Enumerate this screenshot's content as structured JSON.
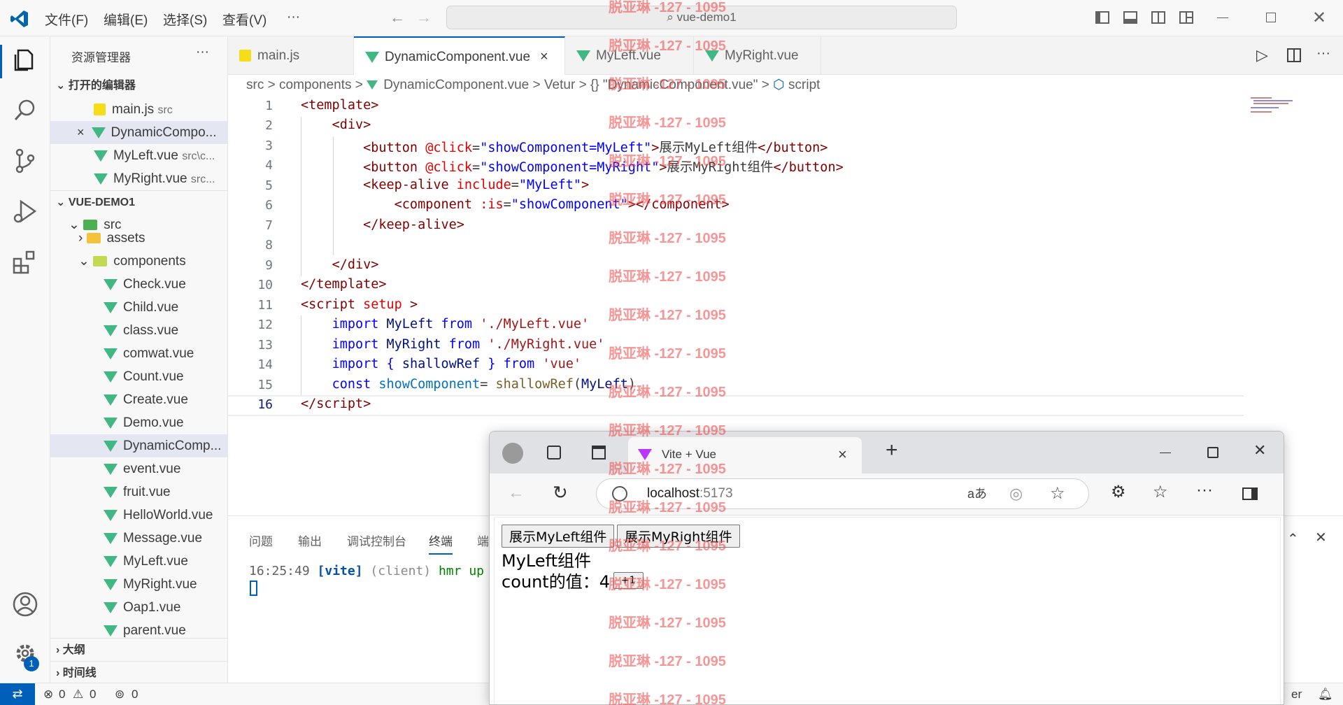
{
  "menu": [
    "文件(F)",
    "编辑(E)",
    "选择(S)",
    "查看(V)",
    "···"
  ],
  "window_title": "vue-demo1",
  "sidebar": {
    "title": "资源管理器",
    "more": "···",
    "open_editors_header": "打开的编辑器",
    "open_editors": [
      {
        "name": "main.js",
        "hint": "src",
        "type": "js"
      },
      {
        "name": "DynamicCompo...",
        "hint": "",
        "type": "vue",
        "close": "×"
      },
      {
        "name": "MyLeft.vue",
        "hint": "src\\c...",
        "type": "vue"
      },
      {
        "name": "MyRight.vue",
        "hint": "src...",
        "type": "vue"
      }
    ],
    "project_header": "VUE-DEMO1",
    "src_folder": "src",
    "assets_folder": "assets",
    "components_folder": "components",
    "files": [
      "Check.vue",
      "Child.vue",
      "class.vue",
      "comwat.vue",
      "Count.vue",
      "Create.vue",
      "Demo.vue",
      "DynamicComp...",
      "event.vue",
      "fruit.vue",
      "HelloWorld.vue",
      "Message.vue",
      "MyLeft.vue",
      "MyRight.vue",
      "Oap1.vue",
      "parent.vue"
    ],
    "outline": "大纲",
    "timeline": "时间线"
  },
  "tabs": [
    {
      "label": "main.js",
      "type": "js"
    },
    {
      "label": "DynamicComponent.vue",
      "type": "vue",
      "close": "×"
    },
    {
      "label": "MyLeft.vue",
      "type": "vue"
    },
    {
      "label": "MyRight.vue",
      "type": "vue"
    }
  ],
  "breadcrumb": [
    "src",
    ">",
    "components",
    ">",
    "DynamicComponent.vue",
    ">",
    "Vetur",
    ">",
    "{} \"DynamicComponent.vue\"",
    ">",
    "script"
  ],
  "editor": {
    "line_numbers": [
      "1",
      "2",
      "3",
      "4",
      "5",
      "6",
      "7",
      "8",
      "9",
      "10",
      "11",
      "12",
      "13",
      "14",
      "15",
      "16"
    ]
  },
  "panel": {
    "tabs": [
      "问题",
      "输出",
      "调试控制台",
      "终端",
      "端"
    ],
    "log_time": "16:25:49",
    "log_tag": "[vite]",
    "log_client": "(client)",
    "log_msg": "hmr up"
  },
  "status": {
    "errors": "0",
    "warnings": "0",
    "ports": "0",
    "right_text": "er",
    "badge": "1"
  },
  "browser": {
    "tab_title": "Vite + Vue",
    "tab_close": "×",
    "new_tab": "+",
    "url_host": "localhost",
    "url_port": ":5173",
    "read_aloud": "aあ",
    "btn_left": "展示MyLeft组件",
    "btn_right": "展示MyRight组件",
    "component_title": "MyLeft组件",
    "count_label": "count的值：4",
    "inc_btn": "+1"
  },
  "watermark": "脱亚琳 -127 - 1095"
}
